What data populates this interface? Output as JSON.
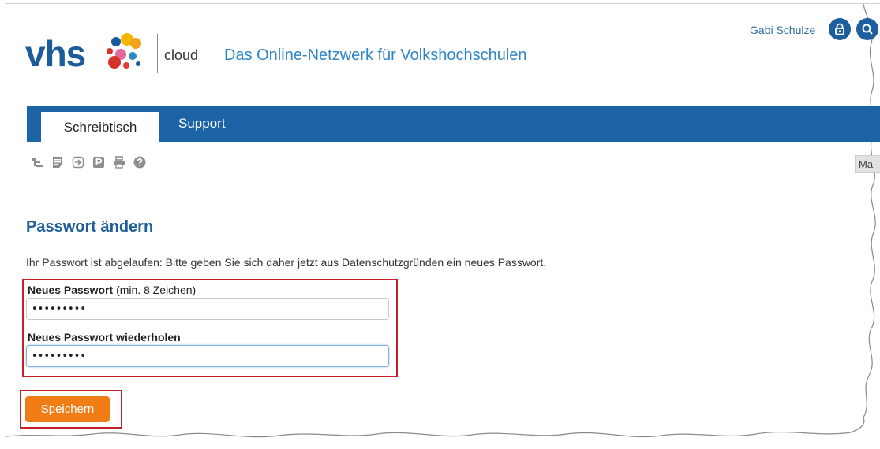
{
  "brand": {
    "logo_text": "vhs",
    "product": "cloud",
    "tagline": "Das Online-Netzwerk für Volkshochschulen"
  },
  "user": {
    "name": "Gabi Schulze",
    "icons": [
      "lock-icon",
      "search-icon"
    ]
  },
  "nav": {
    "tabs": [
      {
        "label": "Schreibtisch",
        "active": true
      },
      {
        "label": "Support",
        "active": false
      }
    ]
  },
  "toolbar": {
    "icons": [
      "structure-icon",
      "notes-icon",
      "export-icon",
      "parking-icon",
      "print-icon",
      "help-icon"
    ],
    "side_tab_label": "Ma"
  },
  "form": {
    "title": "Passwort ändern",
    "info": "Ihr Passwort ist abgelaufen: Bitte geben Sie sich daher jetzt aus Datenschutzgründen ein neues Passwort.",
    "new_password_label": "Neues Passwort",
    "new_password_hint": "(min. 8 Zeichen)",
    "new_password_value": "•••••••••",
    "repeat_password_label": "Neues Passwort wiederholen",
    "repeat_password_value": "•••••••••",
    "save_label": "Speichern"
  },
  "colors": {
    "brand_blue": "#1d64a6",
    "title_blue": "#1f5f98",
    "accent_orange": "#f17d16",
    "highlight_red": "#c62026"
  }
}
